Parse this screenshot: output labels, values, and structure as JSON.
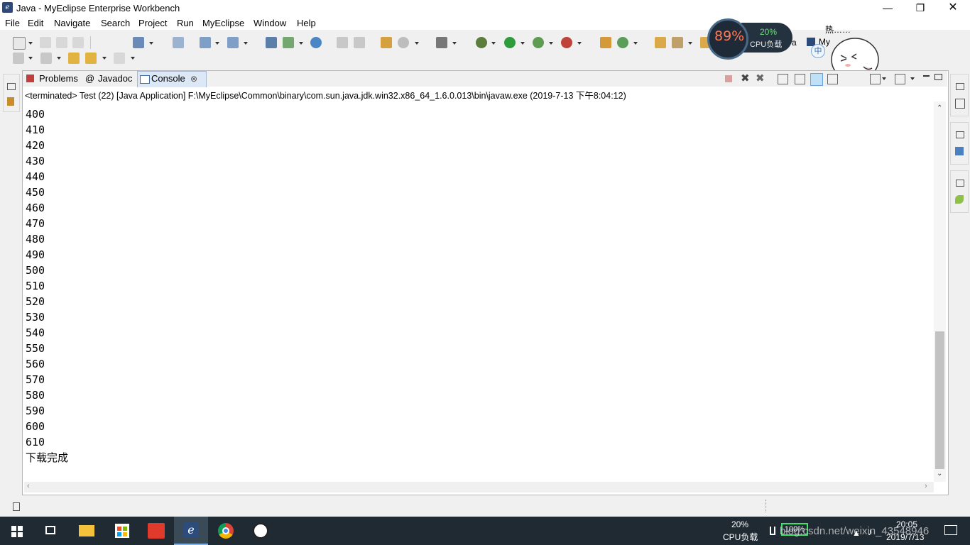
{
  "window": {
    "title": "Java - MyEclipse Enterprise Workbench"
  },
  "menu": [
    "File",
    "Edit",
    "Navigate",
    "Search",
    "Project",
    "Run",
    "MyEclipse",
    "Window",
    "Help"
  ],
  "cpu_widget": {
    "percent": "89%",
    "load": "20%",
    "label": "CPU负载"
  },
  "mascot": {
    "text": "热……",
    "ime": "中"
  },
  "perspective": {
    "partial_label": "a",
    "my_label": "My"
  },
  "tabs": [
    {
      "label": "Problems",
      "icon": "problems-icon"
    },
    {
      "label": "Javadoc",
      "icon": "at-icon"
    },
    {
      "label": "Console",
      "icon": "console-icon",
      "active": true
    }
  ],
  "console": {
    "status": "<terminated> Test (22) [Java Application] F:\\MyEclipse\\Common\\binary\\com.sun.java.jdk.win32.x86_64_1.6.0.013\\bin\\javaw.exe (2019-7-13 下午8:04:12)",
    "lines": [
      "400",
      "410",
      "420",
      "430",
      "440",
      "450",
      "460",
      "470",
      "480",
      "490",
      "500",
      "510",
      "520",
      "530",
      "540",
      "550",
      "560",
      "570",
      "580",
      "590",
      "600",
      "610",
      "下载完成"
    ],
    "scroll_position": 0.79
  },
  "taskbar": {
    "cpu_load": "20%",
    "cpu_label": "CPU负载",
    "battery": "100%",
    "time": "20:05",
    "date": "2019/7/13",
    "watermark": "blog.csdn.net/weixin_43548946"
  }
}
